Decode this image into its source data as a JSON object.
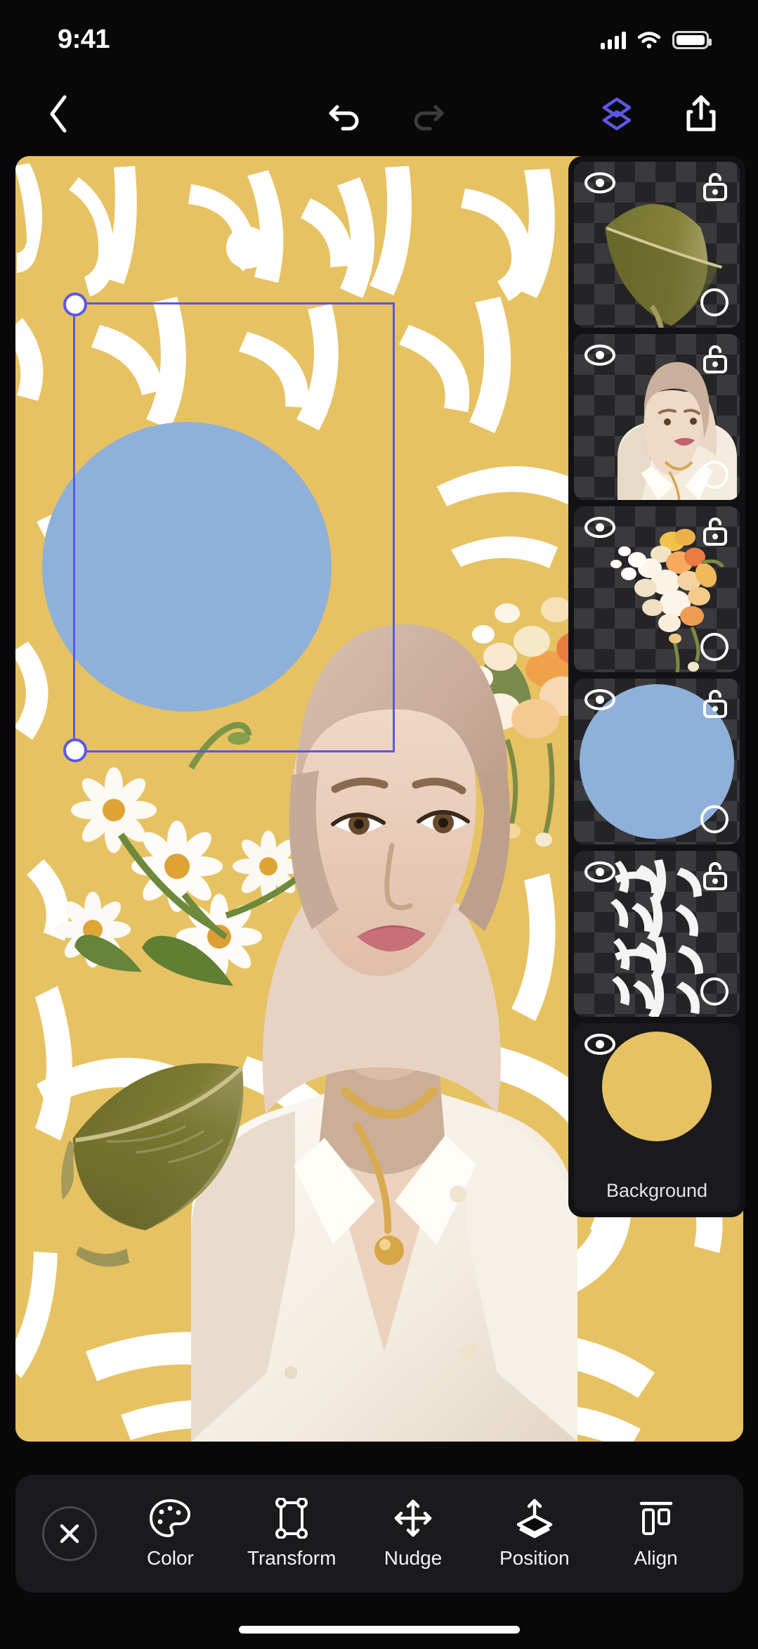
{
  "status_bar": {
    "time": "9:41",
    "cellular_icon": "cellular-signal-icon",
    "wifi_icon": "wifi-icon",
    "battery_icon": "battery-icon"
  },
  "top_toolbar": {
    "back_icon": "chevron-left-icon",
    "undo_icon": "undo-icon",
    "undo_state": "enabled",
    "redo_icon": "redo-icon",
    "redo_state": "disabled",
    "layers_icon": "layers-icon",
    "layers_state": "active",
    "share_icon": "share-export-icon",
    "accent_color": "#5b58e8"
  },
  "canvas": {
    "background_color": "#e6c263",
    "calligraphy_color": "#ffffff",
    "blue_circle_color": "#8fb0d8",
    "selection": {
      "border_color": "#5b58e8",
      "handle_fill": "#ffffff",
      "handles": [
        "top-left",
        "bottom-left"
      ]
    }
  },
  "layers_panel": {
    "layers": [
      {
        "name": "leaf-layer",
        "thumb": "leaf",
        "visible": true,
        "locked": false,
        "selected": false,
        "has_lock": true,
        "has_select_circle": true,
        "label": ""
      },
      {
        "name": "portrait-layer",
        "thumb": "portrait",
        "visible": true,
        "locked": false,
        "selected": true,
        "has_lock": true,
        "has_select_circle": true,
        "label": ""
      },
      {
        "name": "bouquet-layer",
        "thumb": "bouquet",
        "visible": true,
        "locked": false,
        "selected": false,
        "has_lock": true,
        "has_select_circle": true,
        "label": ""
      },
      {
        "name": "blue-circle-layer",
        "thumb": "circle",
        "visible": true,
        "locked": false,
        "selected": false,
        "has_lock": true,
        "has_select_circle": true,
        "label": ""
      },
      {
        "name": "calligraphy-layer",
        "thumb": "calligraphy",
        "visible": true,
        "locked": false,
        "selected": false,
        "has_lock": true,
        "has_select_circle": true,
        "label": ""
      },
      {
        "name": "background-layer",
        "thumb": "swatch",
        "visible": true,
        "locked": false,
        "selected": false,
        "has_lock": false,
        "has_select_circle": false,
        "label": "Background"
      }
    ],
    "eye_icon": "eye-icon",
    "lock_icon": "unlock-padlock-icon",
    "selected_border_color": "#5b58e8"
  },
  "bottom_toolbar": {
    "close_icon": "close-x-icon",
    "items": [
      {
        "label": "Color",
        "icon": "palette-icon"
      },
      {
        "label": "Transform",
        "icon": "transform-box-icon"
      },
      {
        "label": "Nudge",
        "icon": "move-arrows-icon"
      },
      {
        "label": "Position",
        "icon": "position-layer-icon"
      },
      {
        "label": "Align",
        "icon": "align-icon"
      }
    ]
  },
  "home_indicator": "home-indicator-bar"
}
